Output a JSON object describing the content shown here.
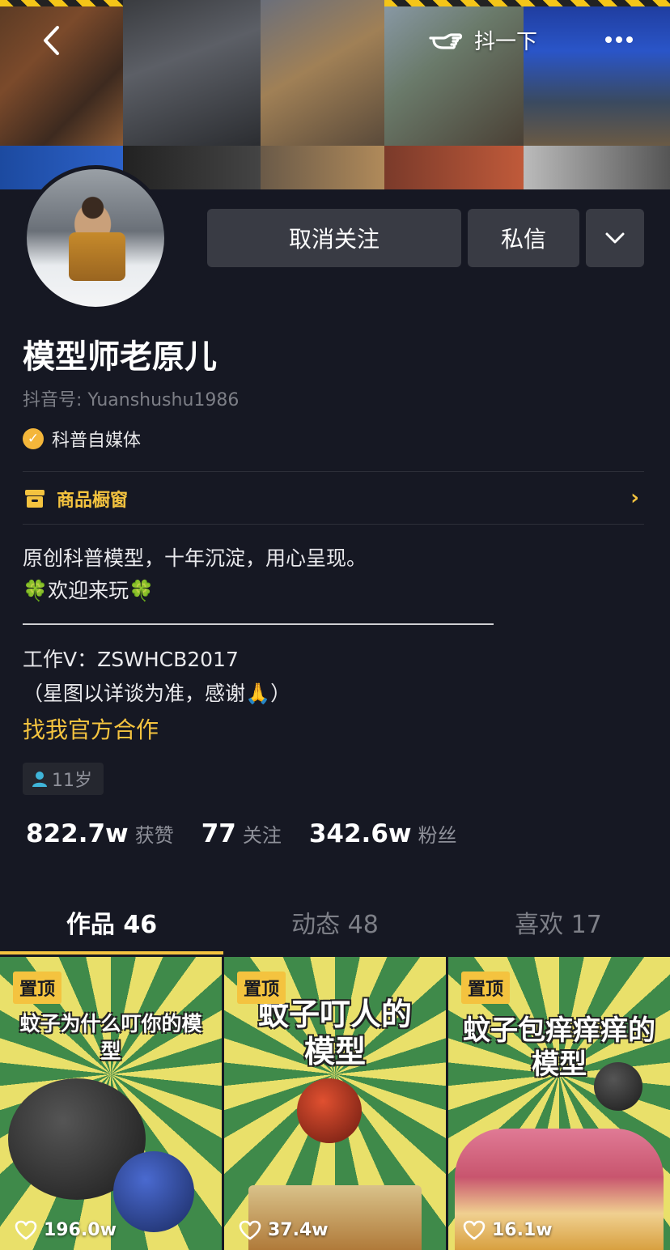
{
  "header": {
    "shake_label": "抖一下",
    "icons": {
      "back": "back-arrow-icon",
      "shake": "pointing-hand-icon",
      "more": "more-dots-icon"
    }
  },
  "actions": {
    "unfollow_label": "取消关注",
    "message_label": "私信",
    "more_icon": "chevron-down-icon"
  },
  "profile": {
    "name": "模型师老原儿",
    "douyin_id": "抖音号: Yuanshushu1986",
    "verification": "科普自媒体",
    "shop_label": "商品橱窗",
    "bio_lines": [
      "原创科普模型，十年沉淀，用心呈现。",
      "🍀欢迎来玩🍀"
    ],
    "contact_lines": [
      "工作V：ZSWHCB2017",
      "（星图以详谈为准，感谢🙏）"
    ],
    "cooperation_link": "找我官方合作",
    "age_tag": "11岁"
  },
  "stats": [
    {
      "value": "822.7w",
      "label": "获赞"
    },
    {
      "value": "77",
      "label": "关注"
    },
    {
      "value": "342.6w",
      "label": "粉丝"
    }
  ],
  "tabs": [
    {
      "label": "作品 46",
      "active": true
    },
    {
      "label": "动态 48",
      "active": false
    },
    {
      "label": "喜欢 17",
      "active": false
    }
  ],
  "videos": [
    {
      "pinned_label": "置顶",
      "caption": "蚊子为什么叮你的模型",
      "likes": "196.0w"
    },
    {
      "pinned_label": "置顶",
      "caption": "蚊子叮人的模型",
      "likes": "37.4w"
    },
    {
      "pinned_label": "置顶",
      "caption": "蚊子包痒痒痒的模型",
      "likes": "16.1w"
    }
  ],
  "colors": {
    "background": "#161823",
    "accent": "#f4c33f",
    "button": "#393b44"
  }
}
